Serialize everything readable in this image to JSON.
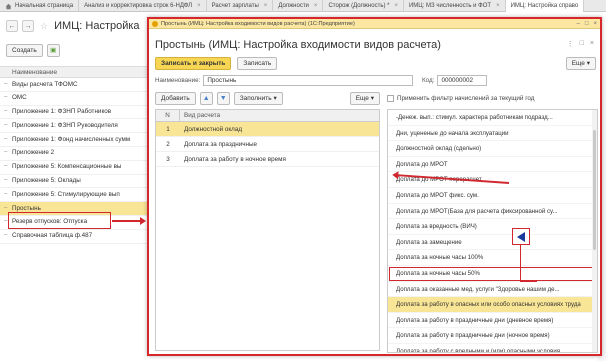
{
  "tabs": [
    {
      "label": "Начальная страница"
    },
    {
      "label": "Анализ и корректировка строк 6-НДФЛ"
    },
    {
      "label": "Расчет зарплаты"
    },
    {
      "label": "Должности"
    },
    {
      "label": "Сторож (Должность) *"
    },
    {
      "label": "ИМЦ: МЗ численность и ФОТ"
    },
    {
      "label": "ИМЦ: Настройка справо"
    }
  ],
  "bg": {
    "title": "ИМЦ: Настройка",
    "create_label": "Создать",
    "column_header": "Наименование",
    "rows": [
      "Виды расчета ТФОМС",
      "ОМС",
      "Приложение 1: ФЗНП Работников",
      "Приложение 1: ФЗНП Руководителя",
      "Приложение 1: Фонд начисленных сумм",
      "Приложение 2",
      "Приложение 5: Компенсационные вы",
      "Приложение 5: Оклады",
      "Приложение 5: Стимулирующие вып",
      "Простынь",
      "Резерв отпусков: Отпуска",
      "Справочная таблица ф.487"
    ],
    "selected_index": 9
  },
  "dialog": {
    "window_title": "Простынь (ИМЦ: Настройка входимости видов расчета) (1С:Предприятие)",
    "heading": "Простынь (ИМЦ: Настройка входимости видов расчета)",
    "save_close_label": "Записать и закрыть",
    "save_label": "Записать",
    "more_label": "Еще",
    "name_label": "Наименование:",
    "name_value": "Простынь",
    "code_label": "Код:",
    "code_value": "000000002",
    "add_label": "Добавить",
    "fill_label": "Заполнить",
    "left_more_label": "Еще",
    "col_n": "N",
    "col_type": "Вид расчета",
    "left_rows": [
      {
        "n": "1",
        "name": "Должностной оклад"
      },
      {
        "n": "2",
        "name": "Доплата за праздничные"
      },
      {
        "n": "3",
        "name": "Доплата за работу в ночное время"
      }
    ],
    "left_selected": 0,
    "filter_label": "Применить фильтр начислений за текущий год",
    "right_rows": [
      "-Денеж. вып.: стимул. характера работникам подразд...",
      "Дни, уцененые до начала эксплуатации",
      "Должностной оклад (сдельно)",
      "Доплата до МРОТ",
      "Доплата до МРОТ перерасчет",
      "Доплата до МРОТ фикс. сум.",
      "Доплата до МРОТ(База для расчета фиксированной су...",
      "Доплата за вредность (ВИЧ)",
      "Доплата за замещение",
      "Доплата за ночные часы 100%",
      "Доплата за ночные часы 50%",
      "Доплата за оказанные мед. услуги \"Здоровье нашим де...",
      "Доплата за работу в опасных или особо опасных условиях труда",
      "Доплата за работу в праздничные дни (дневное время)",
      "Доплата за работу в праздничные дни (ночное время)",
      "Доплата за работу с вредными и (или) опасными условия"
    ],
    "right_selected": 12,
    "right_boxed": 10
  },
  "colors": {
    "accent_red": "#d0282e",
    "selection_yellow": "#f9e596",
    "primary_button": "#f7d654",
    "move_arrow": "#1a3a9c"
  }
}
